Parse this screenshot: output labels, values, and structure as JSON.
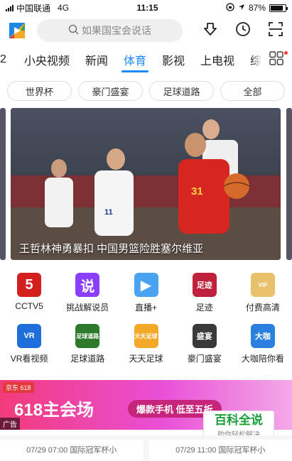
{
  "status_bar": {
    "carrier": "中国联通",
    "network": "4G",
    "time": "11:15",
    "battery": "87%",
    "battery_level": 0.87
  },
  "search": {
    "placeholder": "如果国宝会说话"
  },
  "tabs": [
    {
      "label": "2"
    },
    {
      "label": "小央视频"
    },
    {
      "label": "新闻"
    },
    {
      "label": "体育"
    },
    {
      "label": "影视"
    },
    {
      "label": "上电视"
    },
    {
      "label": "综艺"
    }
  ],
  "active_tab": "体育",
  "chips": [
    "世界杯",
    "豪门盛宴",
    "足球道路",
    "全部"
  ],
  "hero": {
    "caption": "王哲林神勇暴扣 中国男篮险胜塞尔维亚"
  },
  "grid": [
    [
      {
        "label": "CCTV5",
        "icon": "cctv5-icon",
        "color": "#d4201e",
        "glyph": "5"
      },
      {
        "label": "挑战解说员",
        "icon": "commentator-icon",
        "color": "#8a3ffc",
        "glyph": "说"
      },
      {
        "label": "直播+",
        "icon": "live-plus-icon",
        "color": "#4aa3f0",
        "glyph": "▶"
      },
      {
        "label": "足迹",
        "icon": "footprint-icon",
        "color": "#c0213a",
        "glyph": "足迹"
      },
      {
        "label": "付费高清",
        "icon": "vip-icon",
        "color": "#e8c16a",
        "glyph": "VIP"
      }
    ],
    [
      {
        "label": "VR看视频",
        "icon": "vr-icon",
        "color": "#1e6fd9",
        "glyph": "VR"
      },
      {
        "label": "足球道路",
        "icon": "football-road-icon",
        "color": "#2d7a2d",
        "glyph": "足球道路"
      },
      {
        "label": "天天足球",
        "icon": "daily-football-icon",
        "color": "#f2a928",
        "glyph": "天天足球"
      },
      {
        "label": "豪门盛宴",
        "icon": "elite-feast-icon",
        "color": "#3a3a3a",
        "glyph": "盛宴"
      },
      {
        "label": "大咖陪你看",
        "icon": "star-watch-icon",
        "color": "#2a7fe0",
        "glyph": "大咖"
      }
    ]
  ],
  "ad": {
    "brand": "京东",
    "promo": "618",
    "title": "618主会场",
    "button": "爆款手机 低至五折",
    "tag": "广告"
  },
  "watermark": {
    "title": "百科全说",
    "subtitle": "助你轻松解决"
  },
  "matches": [
    {
      "text": "07/29 07:00 国际冠军杯小"
    },
    {
      "text": "07/29 11:00 国际冠军杯小"
    }
  ]
}
